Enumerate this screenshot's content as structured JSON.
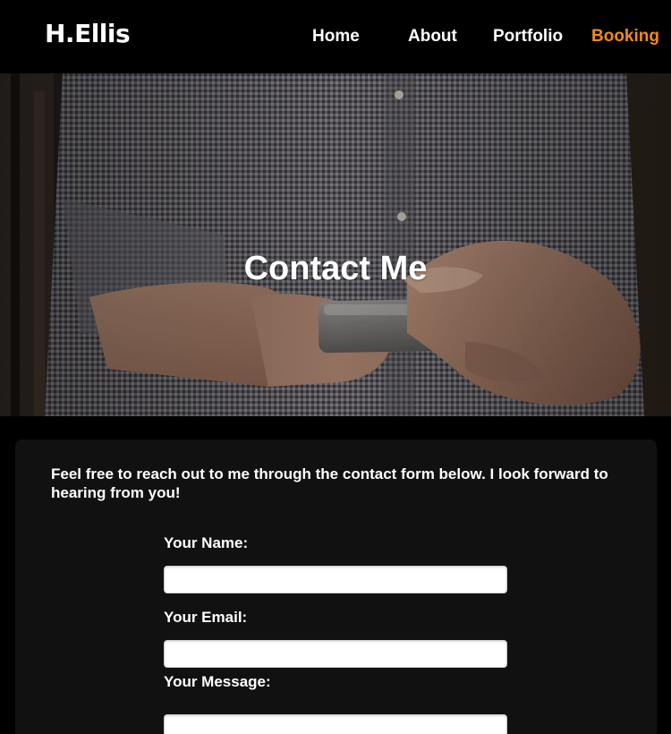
{
  "brand": {
    "logo_text": "H.Ellis"
  },
  "nav": {
    "items": [
      {
        "label": "Home",
        "color": "#ffffff"
      },
      {
        "label": "About",
        "color": "#ffffff"
      },
      {
        "label": "Portfolio",
        "color": "#ffffff"
      },
      {
        "label": "Booking",
        "color": "#f08a1c",
        "active": true
      }
    ]
  },
  "hero": {
    "title": "Contact Me"
  },
  "contact": {
    "intro": "Feel free to reach out to me through the contact form below. I look forward to hearing from you!",
    "name_label": "Your Name:",
    "name_value": "",
    "email_label": "Your Email:",
    "email_value": "",
    "message_label": "Your Message:",
    "message_value": ""
  },
  "colors": {
    "background": "#000000",
    "card": "#111111",
    "accent": "#f08a1c",
    "text": "#ffffff"
  }
}
